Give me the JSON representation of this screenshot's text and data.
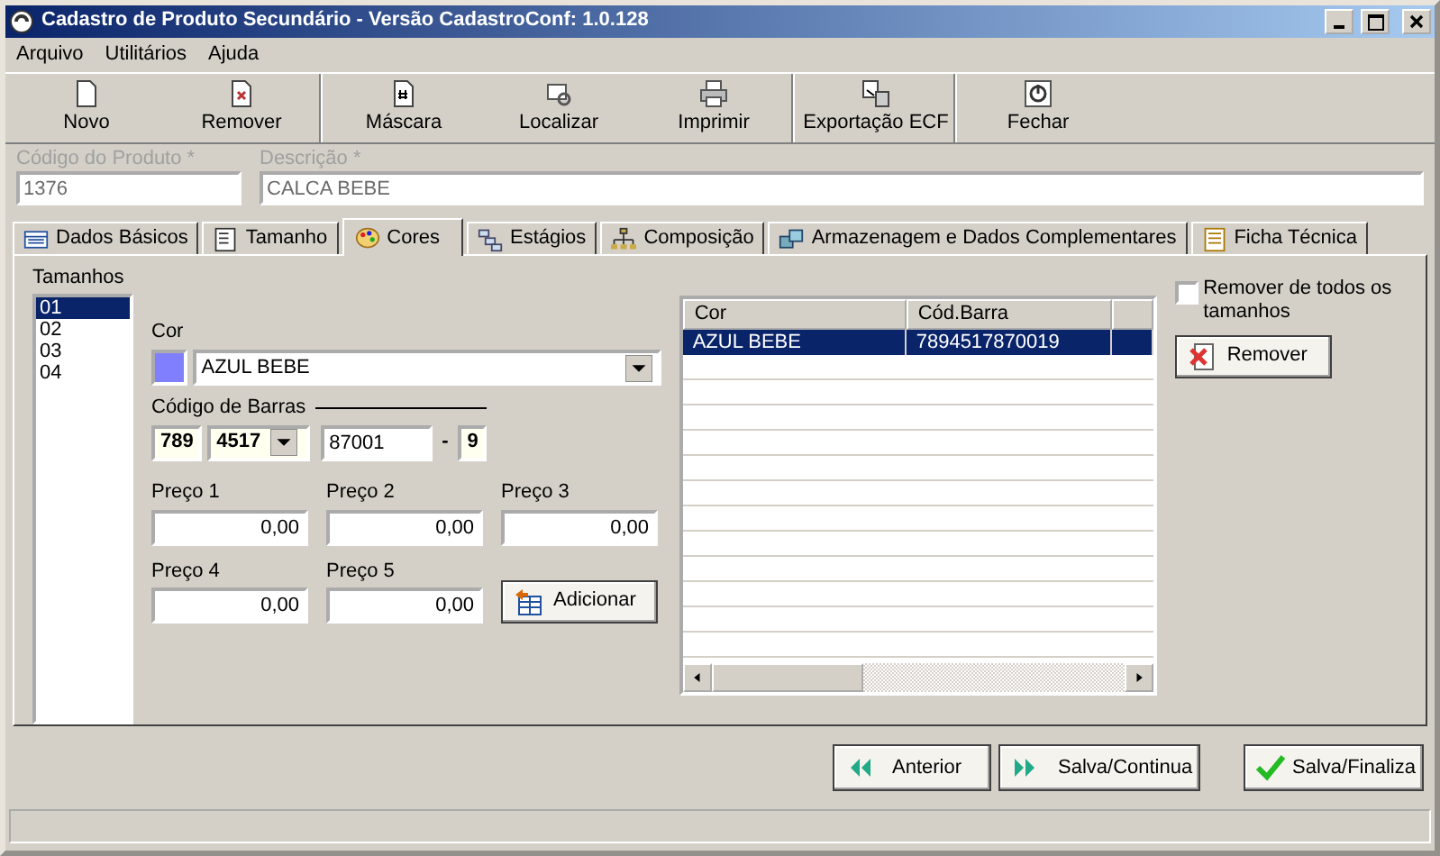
{
  "window": {
    "title": "Cadastro de Produto Secundário - Versão CadastroConf: 1.0.128"
  },
  "menu": [
    {
      "label": "Arquivo"
    },
    {
      "label": "Utilitários"
    },
    {
      "label": "Ajuda"
    }
  ],
  "toolbar": [
    [
      {
        "label": "Novo"
      },
      {
        "label": "Remover"
      }
    ],
    [
      {
        "label": "Máscara"
      },
      {
        "label": "Localizar"
      },
      {
        "label": "Imprimir"
      }
    ],
    [
      {
        "label": "Exportação ECF"
      }
    ],
    [
      {
        "label": "Fechar"
      }
    ]
  ],
  "header": [
    {
      "label": "Código do Produto *",
      "value": "1376",
      "disabled": true
    },
    {
      "label": "Descrição *",
      "value": "CALCA BEBE",
      "disabled": true
    }
  ],
  "tabs": [
    {
      "label": "Dados Básicos",
      "selected": false
    },
    {
      "label": "Tamanho",
      "selected": false
    },
    {
      "label": "Cores",
      "selected": true
    },
    {
      "label": "Estágios",
      "selected": false
    },
    {
      "label": "Composição",
      "selected": false
    },
    {
      "label": "Armazenagem e Dados Complementares",
      "selected": false
    },
    {
      "label": "Ficha Técnica",
      "selected": false
    }
  ],
  "sizes": {
    "label": "Tamanhos",
    "items": [
      {
        "label": "01",
        "selected": true
      },
      {
        "label": "02",
        "selected": false
      },
      {
        "label": "03",
        "selected": false
      },
      {
        "label": "04",
        "selected": false
      }
    ]
  },
  "color_field": {
    "label": "Cor",
    "color": "#8080ff",
    "value": "AZUL BEBE"
  },
  "barcode": {
    "label": "Código de Barras",
    "prefix": "789",
    "company": "4517",
    "item": "87001",
    "separator": "-",
    "check_digit": "9"
  },
  "prices": [
    {
      "label": "Preço 1",
      "value": "0,00"
    },
    {
      "label": "Preço 2",
      "value": "0,00"
    },
    {
      "label": "Preço 3",
      "value": "0,00"
    },
    {
      "label": "Preço 4",
      "value": "0,00"
    },
    {
      "label": "Preço 5",
      "value": "0,00"
    }
  ],
  "add_button": "Adicionar",
  "grid": {
    "columns": [
      "Cor",
      "Cód.Barra"
    ],
    "rows": [
      {
        "cells": [
          "AZUL BEBE",
          "7894517870019"
        ],
        "selected": true
      }
    ]
  },
  "remove_all": {
    "label": "Remover de todos os tamanhos",
    "checked": false
  },
  "remove_button": "Remover",
  "footer_buttons": [
    {
      "label": "Anterior"
    },
    {
      "label": "Salva/Continua"
    },
    {
      "label": "Salva/Finaliza"
    }
  ]
}
